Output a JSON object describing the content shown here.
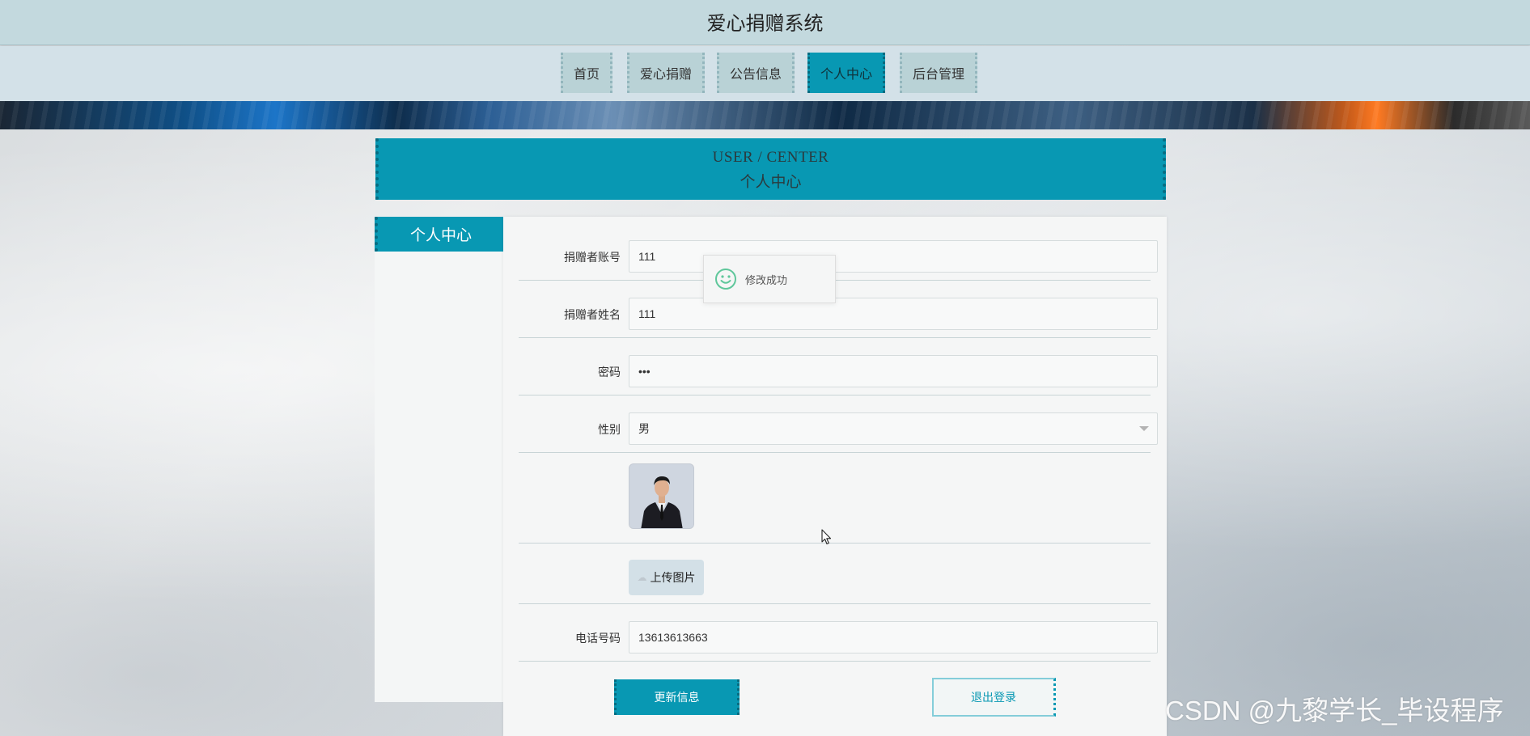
{
  "header": {
    "site_title": "爱心捐赠系统"
  },
  "nav": {
    "items": [
      {
        "label": "首页",
        "active": false
      },
      {
        "label": "爱心捐赠",
        "active": false
      },
      {
        "label": "公告信息",
        "active": false
      },
      {
        "label": "个人中心",
        "active": true
      },
      {
        "label": "后台管理",
        "active": false
      }
    ]
  },
  "section": {
    "title_en": "USER / CENTER",
    "title_cn": "个人中心"
  },
  "sidebar": {
    "tab_label": "个人中心"
  },
  "form": {
    "account_label": "捐赠者账号",
    "account_value": "111",
    "name_label": "捐赠者姓名",
    "name_value": "111",
    "password_label": "密码",
    "password_value": "111",
    "gender_label": "性别",
    "gender_value": "男",
    "upload_label": "上传图片",
    "phone_label": "电话号码",
    "phone_value": "13613613663",
    "update_button": "更新信息",
    "logout_button": "退出登录"
  },
  "toast": {
    "message": "修改成功"
  },
  "watermark": "CSDN @九黎学长_毕设程序",
  "colors": {
    "accent": "#0898b3",
    "topbar": "#c3d9de",
    "navbar": "#d3e1e8",
    "nav_item": "#b9d2d6"
  }
}
